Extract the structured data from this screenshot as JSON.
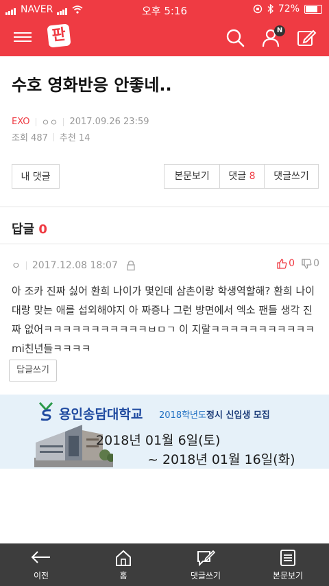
{
  "status_bar": {
    "carrier": "NAVER",
    "time": "오후 5:16",
    "battery": "72%"
  },
  "header": {
    "logo": "판",
    "notification_badge": "N"
  },
  "post": {
    "title": "수호 영화반응 안좋네..",
    "category": "EXO",
    "author": "ㅇㅇ",
    "date": "2017.09.26 23:59",
    "views_label": "조회 487",
    "recommend_label": "추천 14"
  },
  "buttons": {
    "my_comments": "내 댓글",
    "view_post": "본문보기",
    "comments_label": "댓글",
    "comments_count": "8",
    "write_comment": "댓글쓰기"
  },
  "replies": {
    "label": "답글",
    "count": "0"
  },
  "comment": {
    "author": "ㅇ",
    "date": "2017.12.08 18:07",
    "likes": "0",
    "dislikes": "0",
    "text": "아 조카 진짜 싫어 환희 나이가 몇인데 삼촌이랑 학생역할해? 환희 나이대랑 맞는 애를 섭외해야지 아 짜증나 그런 방면에서 엑소 팬들 생각 진짜 없어ㅋㅋㅋㅋㅋㅋㅋㅋㅋㅋㅋㅂㅁㄱ 이 지랄ㅋㅋㅋㅋㅋㅋㅋㅋㅋㅋㅋmi친년들ㅋㅋㅋㅋ",
    "reply_button": "답글쓰기"
  },
  "ad": {
    "school_name": "용인송담대학교",
    "year_text": "2018학년도",
    "recruit_text": "정시 신입생 모집",
    "date_start": "2018년 01월 6일(토)",
    "date_end": "~  2018년 01월 16일(화)"
  },
  "bottom_nav": {
    "items": [
      {
        "label": "이전",
        "icon": "back-arrow-icon"
      },
      {
        "label": "홈",
        "icon": "home-icon"
      },
      {
        "label": "댓글쓰기",
        "icon": "edit-comment-icon"
      },
      {
        "label": "본문보기",
        "icon": "document-icon"
      }
    ]
  },
  "colors": {
    "brand": "#ef3b43",
    "bottom_bar": "#3d3d3d",
    "ad_background": "#e6f1f9"
  }
}
